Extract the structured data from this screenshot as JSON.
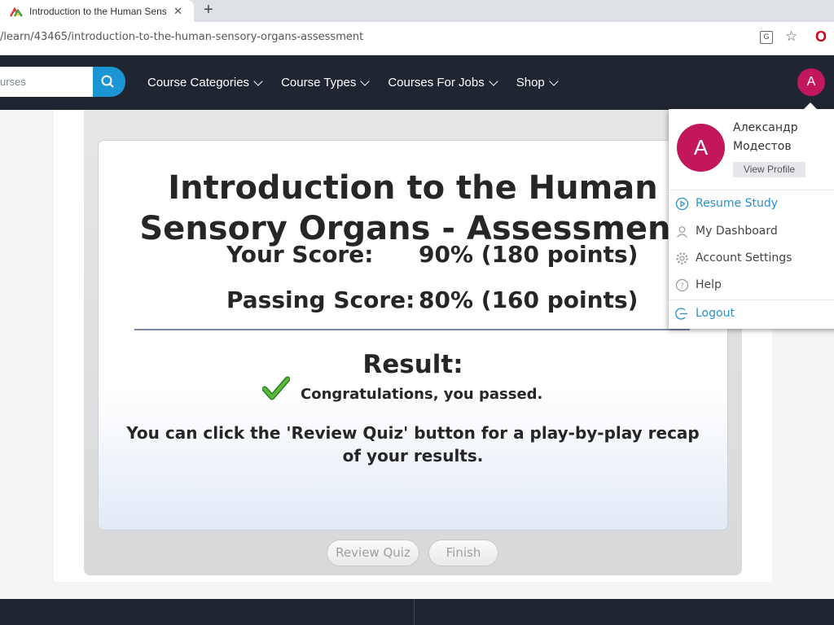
{
  "browser": {
    "tab_title": "Introduction to the Human Sens",
    "new_tab_label": "+",
    "tab_close_label": "✕",
    "url": "/learn/43465/introduction-to-the-human-sensory-organs-assessment"
  },
  "site_nav": {
    "search_placeholder": "urses",
    "links": [
      {
        "label": "Course Categories"
      },
      {
        "label": "Course Types"
      },
      {
        "label": "Courses For Jobs"
      },
      {
        "label": "Shop"
      }
    ],
    "avatar_initial": "A"
  },
  "quiz": {
    "title": "Introduction to the Human Sensory Organs - Assessment",
    "your_score_label": "Your Score:",
    "your_score_value": "90% (180 points)",
    "passing_score_label": "Passing Score:",
    "passing_score_value": "80% (160 points)",
    "result_heading": "Result:",
    "result_message": "Congratulations, you passed.",
    "hint": "You can click the 'Review Quiz' button for a play-by-play recap of your results.",
    "review_button": "Review Quiz",
    "finish_button": "Finish"
  },
  "user_menu": {
    "avatar_initial": "A",
    "first_name": "Александр",
    "last_name": "Модестов",
    "view_profile": "View Profile",
    "items": [
      {
        "label": "Resume Study",
        "icon": "play-circle-icon"
      },
      {
        "label": "My Dashboard",
        "icon": "user-icon"
      },
      {
        "label": "Account Settings",
        "icon": "gear-icon"
      },
      {
        "label": "Help",
        "icon": "help-icon"
      },
      {
        "label": "Logout",
        "icon": "logout-icon"
      }
    ]
  },
  "colors": {
    "nav_bg": "#1f2632",
    "accent_blue": "#1c95d4",
    "avatar_pink": "#c2185b",
    "check_green": "#3e9d2e"
  }
}
